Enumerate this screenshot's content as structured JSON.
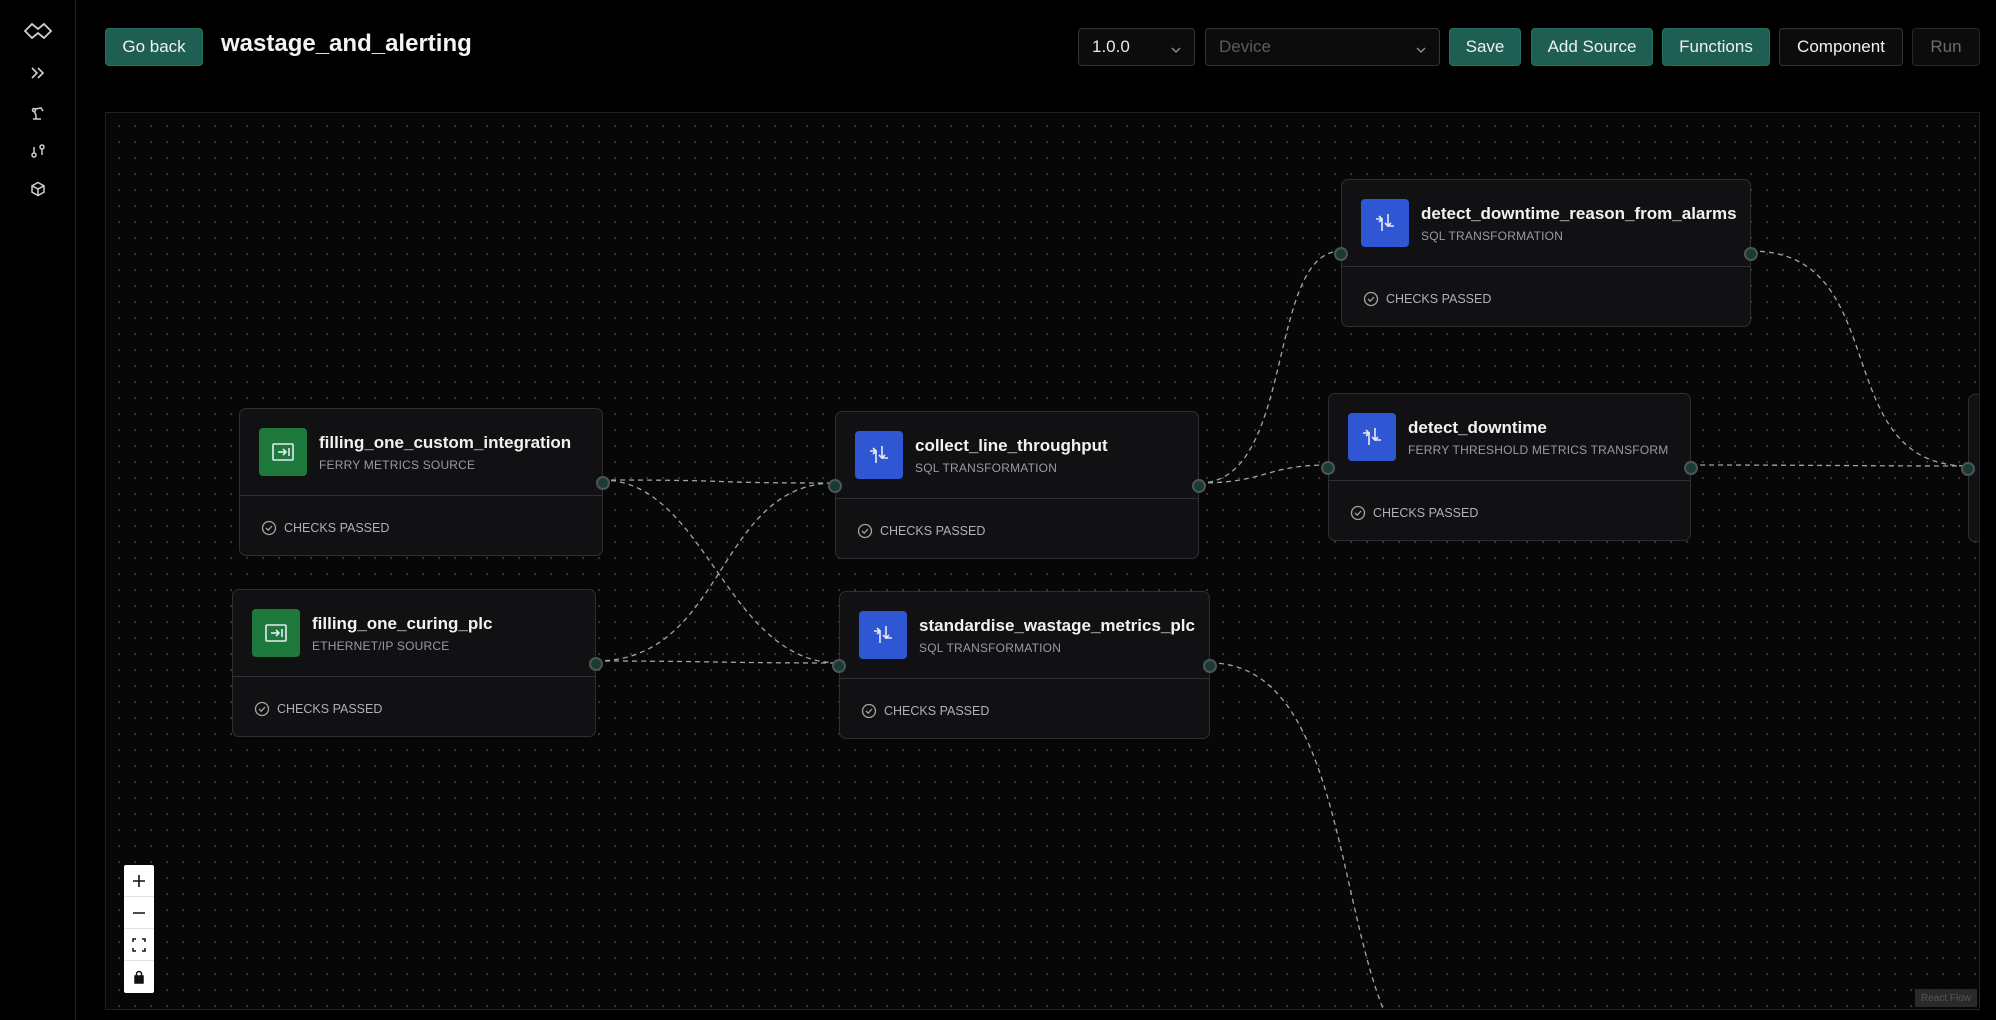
{
  "header": {
    "go_back_label": "Go back",
    "title": "wastage_and_alerting",
    "version_value": "1.0.0",
    "device_placeholder": "Device",
    "save_label": "Save",
    "add_source_label": "Add Source",
    "functions_label": "Functions",
    "component_label": "Component",
    "run_label": "Run"
  },
  "sidebar": {
    "items": [
      {
        "icon": "logo-icon"
      },
      {
        "icon": "expand-chevrons-icon"
      },
      {
        "icon": "robot-arm-icon"
      },
      {
        "icon": "pipeline-icon"
      },
      {
        "icon": "cube-icon"
      }
    ]
  },
  "colors": {
    "accent_teal": "#1e5e53",
    "source_icon_green": "#1d7a3c",
    "transform_icon_blue": "#2f56d3",
    "canvas_bg": "#070707"
  },
  "nodes": [
    {
      "title": "filling_one_custom_integration",
      "type": "FERRY METRICS SOURCE",
      "status": "CHECKS PASSED",
      "kind": "source"
    },
    {
      "title": "filling_one_curing_plc",
      "type": "ETHERNET/IP SOURCE",
      "status": "CHECKS PASSED",
      "kind": "source"
    },
    {
      "title": "collect_line_throughput",
      "type": "SQL TRANSFORMATION",
      "status": "CHECKS PASSED",
      "kind": "transform"
    },
    {
      "title": "standardise_wastage_metrics_plc",
      "type": "SQL TRANSFORMATION",
      "status": "CHECKS PASSED",
      "kind": "transform"
    },
    {
      "title": "detect_downtime_reason_from_alarms",
      "type": "SQL TRANSFORMATION",
      "status": "CHECKS PASSED",
      "kind": "transform"
    },
    {
      "title": "detect_downtime",
      "type": "FERRY THRESHOLD METRICS TRANSFORM",
      "status": "CHECKS PASSED",
      "kind": "transform"
    }
  ],
  "canvas": {
    "attribution": "React Flow"
  }
}
